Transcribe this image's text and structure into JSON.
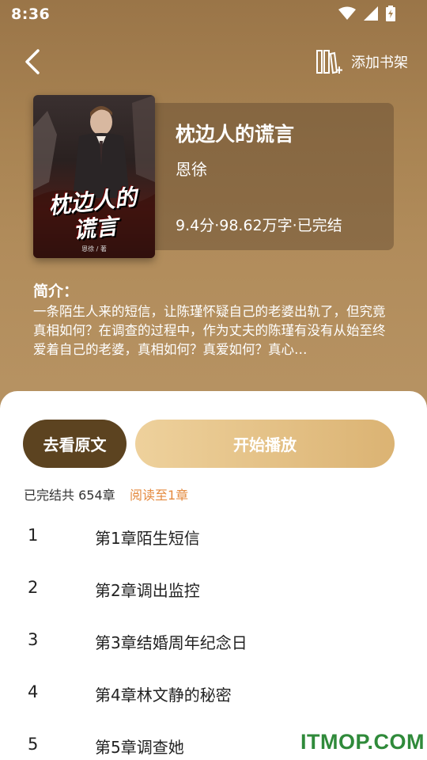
{
  "status_bar": {
    "time": "8:36"
  },
  "header": {
    "add_shelf_label": "添加书架"
  },
  "book": {
    "title": "枕边人的谎言",
    "author": "恩徐",
    "meta": "9.4分·98.62万字·已完结",
    "cover": {
      "title_line1": "枕边人的",
      "title_line2": "谎言",
      "author_credit": "恩徐 / 著"
    }
  },
  "intro": {
    "heading": "简介：",
    "text": "一条陌生人来的短信，让陈瑾怀疑自己的老婆出轨了，但究竟真相如何？在调查的过程中，作为丈夫的陈瑾有没有从始至终爱着自己的老婆，真相如何？真爱如何？真心…"
  },
  "actions": {
    "read_original": "去看原文",
    "start_play": "开始播放"
  },
  "chapters": {
    "summary": "已完结共 654章",
    "progress": "阅读至1章",
    "items": [
      {
        "num": "1",
        "title": "第1章陌生短信"
      },
      {
        "num": "2",
        "title": "第2章调出监控"
      },
      {
        "num": "3",
        "title": "第3章结婚周年纪念日"
      },
      {
        "num": "4",
        "title": "第4章林文静的秘密"
      },
      {
        "num": "5",
        "title": "第5章调查她"
      }
    ]
  },
  "watermark": "ITMOP.COM",
  "colors": {
    "accent_dark": "#5c4320",
    "accent_gold": "#dbb373",
    "progress": "#e48a3e"
  }
}
